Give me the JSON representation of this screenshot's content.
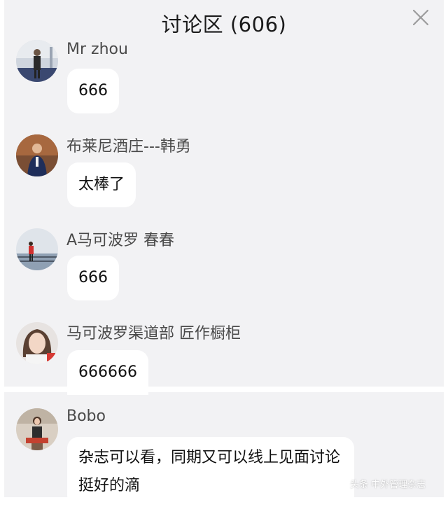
{
  "header": {
    "title": "讨论区 (606)",
    "close_icon": "close-icon"
  },
  "comments": [
    {
      "name": "Mr zhou",
      "message": "666"
    },
    {
      "name": "布莱尼酒庄---韩勇",
      "message": "太棒了"
    },
    {
      "name": "A马可波罗 春春",
      "message": "666"
    },
    {
      "name": "马可波罗渠道部 匠作橱柜",
      "message": "666666"
    },
    {
      "name": "Bobo",
      "message": "杂志可以看，同期又可以线上见面讨论挺好的滴"
    }
  ],
  "watermark": "头条 中外管理杂志",
  "colors": {
    "panel": "#f2f2f4",
    "bubble": "#ffffff",
    "name_text": "#4a4a4a"
  }
}
